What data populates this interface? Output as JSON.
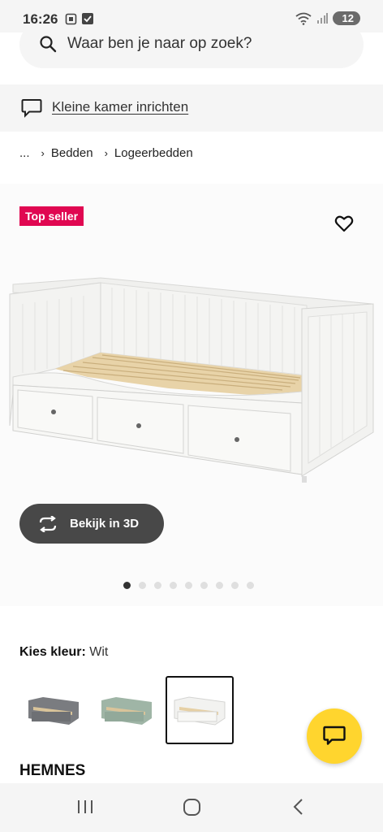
{
  "status_bar": {
    "time": "16:26",
    "battery": "12"
  },
  "search": {
    "placeholder": "Waar ben je naar op zoek?"
  },
  "room_banner": {
    "label": "Kleine kamer inrichten"
  },
  "breadcrumb": {
    "ellipsis": "...",
    "items": [
      "Bedden",
      "Logeerbedden"
    ]
  },
  "product": {
    "badge": "Top seller",
    "view_3d_label": "Bekijk in 3D",
    "image_count": 9,
    "active_image_index": 0,
    "color_label": "Kies kleur:",
    "color_value": "Wit",
    "swatches": [
      {
        "name": "grijs",
        "color": "#7a7c80"
      },
      {
        "name": "groen",
        "color": "#9fb5a6"
      },
      {
        "name": "wit",
        "color": "#f2f2f0",
        "selected": true
      }
    ],
    "name": "HEMNES"
  },
  "colors": {
    "badge": "#e00751",
    "chat": "#ffd52e",
    "button_dark": "#484848"
  }
}
